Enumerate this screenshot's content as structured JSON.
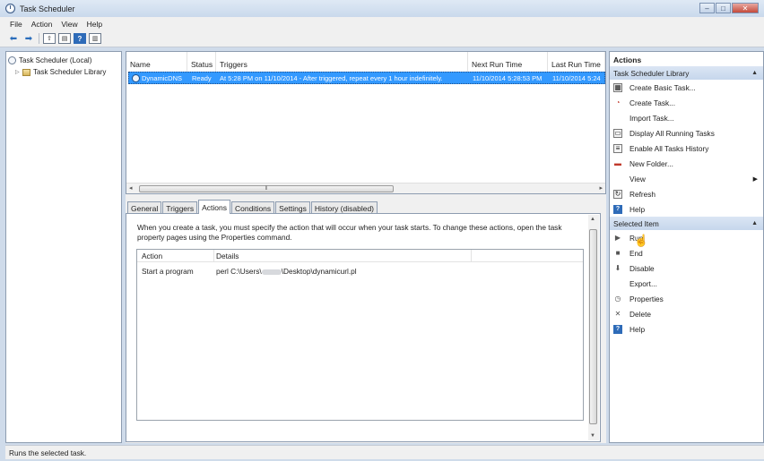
{
  "window": {
    "title": "Task Scheduler"
  },
  "menu": [
    "File",
    "Action",
    "View",
    "Help"
  ],
  "tree": {
    "root": "Task Scheduler (Local)",
    "child": "Task Scheduler Library"
  },
  "task_list": {
    "columns": [
      "Name",
      "Status",
      "Triggers",
      "Next Run Time",
      "Last Run Time"
    ],
    "rows": [
      {
        "name": "DynamicDNS",
        "status": "Ready",
        "triggers": "At 5:28 PM on 11/10/2014 - After triggered, repeat every 1 hour indefinitely.",
        "next_run": "11/10/2014 5:28:53 PM",
        "last_run": "11/10/2014 5:24"
      }
    ]
  },
  "tabs": [
    "General",
    "Triggers",
    "Actions",
    "Conditions",
    "Settings",
    "History (disabled)"
  ],
  "active_tab": "Actions",
  "actions_tab": {
    "description": "When you create a task, you must specify the action that will occur when your task starts.  To change these actions, open the task property pages using the Properties command.",
    "columns": [
      "Action",
      "Details"
    ],
    "rows": [
      {
        "action": "Start a program",
        "details_prefix": "perl C:\\Users\\",
        "details_suffix": "\\Desktop\\dynamicurl.pl"
      }
    ]
  },
  "actions_pane": {
    "title": "Actions",
    "library_section": {
      "title": "Task Scheduler Library",
      "items": [
        {
          "label": "Create Basic Task...",
          "icon": "calendar-wand-icon"
        },
        {
          "label": "Create Task...",
          "icon": "task-icon"
        },
        {
          "label": "Import Task...",
          "icon": ""
        },
        {
          "label": "Display All Running Tasks",
          "icon": "running-tasks-icon"
        },
        {
          "label": "Enable All Tasks History",
          "icon": "history-icon"
        },
        {
          "label": "New Folder...",
          "icon": "folder-icon"
        },
        {
          "label": "View",
          "icon": ""
        },
        {
          "label": "Refresh",
          "icon": "refresh-icon"
        },
        {
          "label": "Help",
          "icon": "help-icon"
        }
      ]
    },
    "selected_section": {
      "title": "Selected Item",
      "items": [
        {
          "label": "Run",
          "icon": "run-icon"
        },
        {
          "label": "End",
          "icon": "stop-icon"
        },
        {
          "label": "Disable",
          "icon": "disable-icon"
        },
        {
          "label": "Export...",
          "icon": ""
        },
        {
          "label": "Properties",
          "icon": "properties-icon"
        },
        {
          "label": "Delete",
          "icon": "delete-icon"
        },
        {
          "label": "Help",
          "icon": "help-icon"
        }
      ]
    }
  },
  "status_bar": "Runs the selected task.",
  "colors": {
    "selection": "#3399ff",
    "section_header": "#c6d7ec",
    "titlebar": "#cfdbea"
  }
}
